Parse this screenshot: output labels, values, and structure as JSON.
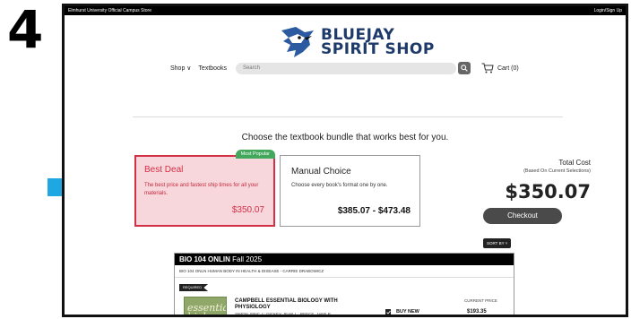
{
  "tutorial": {
    "step_number": "4"
  },
  "topbar": {
    "store_name": "Elmhurst University Official Campus Store",
    "login": "Login/Sign Up"
  },
  "logo": {
    "line1": "BLUEJAY",
    "line2": "SPIRIT SHOP"
  },
  "nav": {
    "shop": "Shop ∨",
    "textbooks": "Textbooks",
    "search_placeholder": "Search",
    "cart": "Cart (0)"
  },
  "bundle": {
    "headline": "Choose the textbook bundle that works best for you.",
    "best_deal": {
      "badge": "Most Popular",
      "title": "Best Deal",
      "description": "The best price and fastest ship times for all your materials.",
      "price": "$350.07"
    },
    "manual_choice": {
      "title": "Manual Choice",
      "description": "Choose every book's format one by one.",
      "price": "$385.07 - $473.48"
    },
    "total": {
      "label": "Total Cost",
      "sublabel": "(Based On Current Selections)",
      "value": "$350.07",
      "checkout": "Checkout"
    }
  },
  "sort_by": "SORT BY ˅",
  "course": {
    "code": "BIO 104 ONLIN",
    "term": "Fall 2025",
    "subtitle": "BIO 104 ONLN HUMAN BODY IN HEALTH & DISEASE - CARRIE DRABOWICZ",
    "required_tag": "REQUIRED",
    "book": {
      "cover_line1": "essential",
      "cover_line2": "biology",
      "title": "CAMPBELL ESSENTIAL BIOLOGY WITH PHYSIOLOGY",
      "authors": "SIMON, ERIC J.; DICKEY, JEAN L.; REECE, JANE B.",
      "option": "BUY NEW",
      "price_label": "CURRENT PRICE",
      "price": "$193.35"
    }
  },
  "colors": {
    "accent_red": "#d32f45",
    "popular_green": "#43a85b",
    "arrow_blue": "#1ea7e1",
    "logo_navy": "#1d3a6a"
  }
}
